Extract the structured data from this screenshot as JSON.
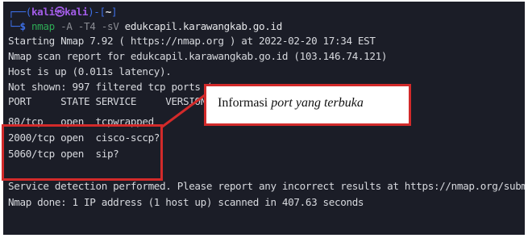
{
  "terminal": {
    "prompt": {
      "open": "┌──(",
      "user": "kali",
      "at": "㉿",
      "host": "kali",
      "close": ")-[",
      "path": "~",
      "end": "]",
      "corner": "└─",
      "dollar": "$ "
    },
    "command": {
      "name": "nmap",
      "args": " -A -T4 -sV ",
      "target": "edukcapil.karawangkab.go.id"
    },
    "lines": [
      "Starting Nmap 7.92 ( https://nmap.org ) at 2022-02-20 17:34 EST",
      "Nmap scan report for edukcapil.karawangkab.go.id (103.146.74.121)",
      "Host is up (0.011s latency).",
      "Not shown: 997 filtered tcp ports (n",
      "PORT     STATE SERVICE     VERSION",
      "80/tcp   open  tcpwrapped",
      "2000/tcp open  cisco-sccp?",
      "5060/tcp open  sip?",
      "",
      "Service detection performed. Please report any incorrect results at https://nmap.org/submit/ .",
      "Nmap done: 1 IP address (1 host up) scanned in 407.63 seconds"
    ]
  },
  "annotation": {
    "text_plain": "Informasi ",
    "text_italic": "port yang terbuka",
    "color": "#d22a2a"
  },
  "colors": {
    "background": "#1b1d27",
    "text": "#d7d9de",
    "prompt_blue": "#3d6fe6",
    "prompt_purple": "#a35de8",
    "command_green": "#2dab55",
    "highlight_red": "#d22a2a"
  }
}
